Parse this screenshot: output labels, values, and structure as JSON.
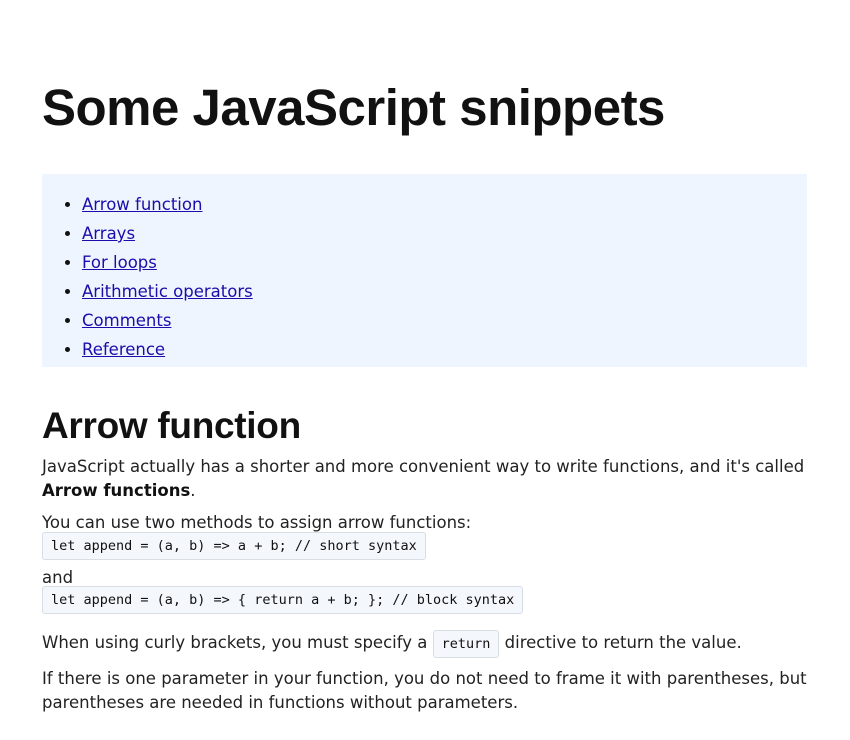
{
  "title": "Some JavaScript snippets",
  "toc": {
    "items": [
      {
        "label": "Arrow function"
      },
      {
        "label": "Arrays"
      },
      {
        "label": "For loops"
      },
      {
        "label": "Arithmetic operators"
      },
      {
        "label": "Comments"
      },
      {
        "label": "Reference"
      }
    ]
  },
  "section": {
    "heading": "Arrow function",
    "intro_line1": "JavaScript actually has a shorter and more convenient way to write functions, and it's called",
    "intro_bold": "Arrow functions",
    "intro_end": ".",
    "methods_text": "You can use two methods to assign arrow functions:",
    "code_short": "let append = (a, b) => a + b; // short syntax",
    "and_text": "and",
    "code_block": "let append = (a, b) => { return a + b; }; // block syntax",
    "curly_before": "When using curly brackets, you must specify a",
    "curly_code": "return",
    "curly_after": "directive to return the value.",
    "param_line1": "If there is one parameter in your function, you do not need to frame it with parentheses, but",
    "param_line2": "parentheses are needed in functions without parameters."
  },
  "colors": {
    "toc_background": "#eef5fe",
    "link": "#1a0dab",
    "code_background": "#f4f8fc"
  }
}
